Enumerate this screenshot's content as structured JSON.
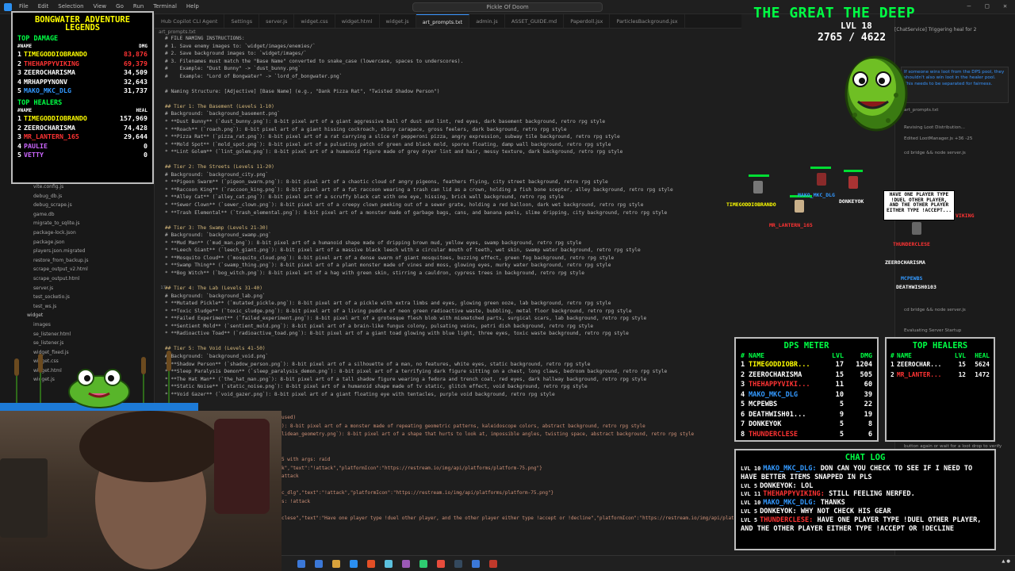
{
  "titlebar": {
    "menu": [
      "File",
      "Edit",
      "Selection",
      "View",
      "Go",
      "Run",
      "Terminal",
      "Help"
    ],
    "search": "Pickle Of Doom"
  },
  "tabs": [
    "Hub Copilot CLI Agent",
    "Settings",
    "server.js",
    "widget.css",
    "widget.html",
    "widget.js",
    "art_prompts.txt",
    "admin.js",
    "ASSET_GUIDE.md",
    "Paperdoll.jsx",
    "ParticlesBackground.jsx"
  ],
  "breadcrumb": "art_prompts.txt",
  "explorer": {
    "files": [
      {
        "name": "vite.config.js",
        "folder": false
      },
      {
        "name": "debug_db.js",
        "folder": false
      },
      {
        "name": "debug_scrape.js",
        "folder": false
      },
      {
        "name": "game.db",
        "folder": false
      },
      {
        "name": "migrate_to_sqlite.js",
        "folder": false
      },
      {
        "name": "package-lock.json",
        "folder": false
      },
      {
        "name": "package.json",
        "folder": false
      },
      {
        "name": "players.json.migrated",
        "folder": false
      },
      {
        "name": "restore_from_backup.js",
        "folder": false
      },
      {
        "name": "scrape_output_v2.html",
        "folder": false
      },
      {
        "name": "scrape_output.html",
        "folder": false
      },
      {
        "name": "server.js",
        "folder": false
      },
      {
        "name": "test_socketio.js",
        "folder": false
      },
      {
        "name": "test_ws.js",
        "folder": false
      },
      {
        "name": "widget",
        "folder": true
      },
      {
        "name": "images",
        "folder": false
      },
      {
        "name": "se_listener.html",
        "folder": false
      },
      {
        "name": "se_listener.js",
        "folder": false
      },
      {
        "name": "widget_fixed.js",
        "folder": false
      },
      {
        "name": "widget.css",
        "folder": false
      },
      {
        "name": "widget.html",
        "folder": false
      },
      {
        "name": "widget.js",
        "folder": false
      }
    ]
  },
  "editor": {
    "lines": [
      {
        "n": "",
        "text": "# FILE NAMING INSTRUCTIONS:",
        "h": false
      },
      {
        "n": "",
        "text": "# 1. Save enemy images to: `widget/images/enemies/`",
        "h": false
      },
      {
        "n": "",
        "text": "# 2. Save background images to: `widget/images/`",
        "h": false
      },
      {
        "n": "",
        "text": "# 3. Filenames must match the \"Base Name\" converted to snake_case (lowercase, spaces to underscores).",
        "h": false
      },
      {
        "n": "",
        "text": "#    Example: \"Dust Bunny\" -> `dust_bunny.png`",
        "h": false
      },
      {
        "n": "",
        "text": "#    Example: \"Lord of Bongwater\" -> `lord_of_bongwater.png`",
        "h": false
      },
      {
        "n": "",
        "text": "",
        "h": false
      },
      {
        "n": "",
        "text": "# Naming Structure: [Adjective] [Base Name] (e.g., \"Dank Pizza Rat\", \"Twisted Shadow Person\")",
        "h": false
      },
      {
        "n": "",
        "text": "",
        "h": false
      },
      {
        "n": "",
        "text": "## Tier 1: The Basement (Levels 1-10)",
        "h": true
      },
      {
        "n": "",
        "text": "# Background: `background_basement.png`",
        "h": false
      },
      {
        "n": "",
        "text": "* **Dust Bunny** (`dust_bunny.png`): 8-bit pixel art of a giant aggressive ball of dust and lint, red eyes, dark basement background, retro rpg style",
        "h": false
      },
      {
        "n": "",
        "text": "* **Roach** (`roach.png`): 8-bit pixel art of a giant hissing cockroach, shiny carapace, gross feelers, dark background, retro rpg style",
        "h": false
      },
      {
        "n": "",
        "text": "* **Pizza Rat** (`pizza_rat.png`): 8-bit pixel art of a rat carrying a slice of pepperoni pizza, angry expression, subway tile background, retro rpg style",
        "h": false
      },
      {
        "n": "",
        "text": "* **Mold Spot** (`mold_spot.png`): 8-bit pixel art of a pulsating patch of green and black mold, spores floating, damp wall background, retro rpg style",
        "h": false
      },
      {
        "n": "",
        "text": "* **Lint Golem** (`lint_golem.png`): 8-bit pixel art of a humanoid figure made of grey dryer lint and hair, messy texture, dark background, retro rpg style",
        "h": false
      },
      {
        "n": "",
        "text": "",
        "h": false
      },
      {
        "n": "",
        "text": "## Tier 2: The Streets (Levels 11-20)",
        "h": true
      },
      {
        "n": "",
        "text": "# Background: `background_city.png`",
        "h": false
      },
      {
        "n": "",
        "text": "* **Pigeon Swarm** (`pigeon_swarm.png`): 8-bit pixel art of a chaotic cloud of angry pigeons, feathers flying, city street background, retro rpg style",
        "h": false
      },
      {
        "n": "",
        "text": "* **Raccoon King** (`raccoon_king.png`): 8-bit pixel art of a fat raccoon wearing a trash can lid as a crown, holding a fish bone scepter, alley background, retro rpg style",
        "h": false
      },
      {
        "n": "",
        "text": "* **Alley Cat** (`alley_cat.png`): 8-bit pixel art of a scruffy black cat with one eye, hissing, brick wall background, retro rpg style",
        "h": false
      },
      {
        "n": "",
        "text": "* **Sewer Clown** (`sewer_clown.png`): 8-bit pixel art of a creepy clown peeking out of a sewer grate, holding a red balloon, dark wet background, retro rpg style",
        "h": false
      },
      {
        "n": "",
        "text": "* **Trash Elemental** (`trash_elemental.png`): 8-bit pixel art of a monster made of garbage bags, cans, and banana peels, slime dripping, city background, retro rpg style",
        "h": false
      },
      {
        "n": "",
        "text": "",
        "h": false
      },
      {
        "n": "",
        "text": "## Tier 3: The Swamp (Levels 21-30)",
        "h": true
      },
      {
        "n": "",
        "text": "# Background: `background_swamp.png`",
        "h": false
      },
      {
        "n": "",
        "text": "* **Mud Man** (`mud_man.png`): 8-bit pixel art of a humanoid shape made of dripping brown mud, yellow eyes, swamp background, retro rpg style",
        "h": false
      },
      {
        "n": "",
        "text": "* **Leech Giant** (`leech_giant.png`): 8-bit pixel art of a massive black leech with a circular mouth of teeth, wet skin, swamp water background, retro rpg style",
        "h": false
      },
      {
        "n": "",
        "text": "* **Mosquito Cloud** (`mosquito_cloud.png`): 8-bit pixel art of a dense swarm of giant mosquitoes, buzzing effect, green fog background, retro rpg style",
        "h": false
      },
      {
        "n": "",
        "text": "* **Swamp Thing** (`swamp_thing.png`): 8-bit pixel art of a plant monster made of vines and moss, glowing eyes, murky water background, retro rpg style",
        "h": false
      },
      {
        "n": "",
        "text": "* **Bog Witch** (`bog_witch.png`): 8-bit pixel art of a hag with green skin, stirring a cauldron, cypress trees in background, retro rpg style",
        "h": false
      },
      {
        "n": "",
        "text": "",
        "h": false
      },
      {
        "n": "17",
        "text": "## Tier 4: The Lab (Levels 31-40)",
        "h": true
      },
      {
        "n": "",
        "text": "# Background: `background_lab.png`",
        "h": false
      },
      {
        "n": "",
        "text": "* **Mutated Pickle** (`mutated_pickle.png`): 8-bit pixel art of a pickle with extra limbs and eyes, glowing green ooze, lab background, retro rpg style",
        "h": false
      },
      {
        "n": "",
        "text": "* **Toxic Sludge** (`toxic_sludge.png`): 8-bit pixel art of a living puddle of neon green radioactive waste, bubbling, metal floor background, retro rpg style",
        "h": false
      },
      {
        "n": "",
        "text": "* **Failed Experiment** (`failed_experiment.png`): 8-bit pixel art of a grotesque flesh blob with mismatched parts, surgical scars, lab background, retro rpg style",
        "h": false
      },
      {
        "n": "",
        "text": "* **Sentient Mold** (`sentient_mold.png`): 8-bit pixel art of a brain-like fungus colony, pulsating veins, petri dish background, retro rpg style",
        "h": false
      },
      {
        "n": "",
        "text": "* **Radioactive Toad** (`radioactive_toad.png`): 8-bit pixel art of a giant toad glowing with blue light, three eyes, toxic waste background, retro rpg style",
        "h": false
      },
      {
        "n": "",
        "text": "",
        "h": false
      },
      {
        "n": "",
        "text": "## Tier 5: The Void (Levels 41-50)",
        "h": true
      },
      {
        "n": "",
        "text": "# Background: `background_void.png`",
        "h": false
      },
      {
        "n": "",
        "text": "* **Shadow Person** (`shadow_person.png`): 8-bit pixel art of a silhouette of a man, no features, white eyes, static background, retro rpg style",
        "h": false
      },
      {
        "n": "",
        "text": "* **Sleep Paralysis Demon** (`sleep_paralysis_demon.png`): 8-bit pixel art of a terrifying dark figure sitting on a chest, long claws, bedroom background, retro rpg style",
        "h": false
      },
      {
        "n": "",
        "text": "* **The Hat Man** (`the_hat_man.png`): 8-bit pixel art of a tall shadow figure wearing a fedora and trench coat, red eyes, dark hallway background, retro rpg style",
        "h": false
      },
      {
        "n": "",
        "text": "* **Static Noise** (`static_noise.png`): 8-bit pixel art of a humanoid shape made of tv static, glitch effect, void background, retro rpg style",
        "h": false
      },
      {
        "n": "",
        "text": "* **Void Gazer** (`void_gazer.png`): 8-bit pixel art of a giant floating eye with tentacles, purple void background, retro rpg style",
        "h": false
      }
    ],
    "log": [
      "used)",
      "): 8-bit pixel art of a monster made of repeating geometric patterns, kaleidoscope colors, abstract background, retro rpg style",
      "lidean_geometry.png`): 8-bit pixel art of a shape that hurts to look at, impossible angles, twisting space, abstract background, retro rpg style",
      "",
      "",
      "5 with args: raid",
      "k\",\"text\":\"!attack\",\"platformIcon\":\"https://restream.io/img/api/platforms/platform-75.png\"}",
      "attack",
      "",
      "c_dlg\",\"text\":\"!attack\",\"platformIcon\":\"https://restream.io/img/api/platforms/platform-75.png\"}",
      "s: !attack",
      "",
      "clese\",\"text\":\"Have one player type !duel other player, and the other player either type !accept or !decline\",\"platformIcon\":\"https://restream.io/img/api/platforms/platform-75.png\"}"
    ]
  },
  "side_panel": {
    "service": "[ChatService] Triggering heal for 2",
    "copilot_note": "If someone wins loot from the DPS pool, they shouldn't also win loot in the healer pool. This needs to be separated for fairness.",
    "items": [
      "art_prompts.txt",
      "Revising Loot Distribution...",
      "Edited LootManager.js +36 -25",
      "cd bridge && node server.js",
      "cd bridge && node server.js",
      "Evaluating Server Startup",
      "button again or wait for a loot drop to verify"
    ]
  },
  "legends": {
    "title": "BONGWATER ADVENTURE LEGENDS",
    "damage_title": "TOP DAMAGE",
    "damage_cols": [
      "#NAME",
      "DMG"
    ],
    "damage": [
      {
        "rank": "1",
        "name": "TIMEGODDIOBRANDO",
        "value": "83,876",
        "color": "#ffff00",
        "vcolor": "#ff3333"
      },
      {
        "rank": "2",
        "name": "THEHAPPYVIKING",
        "value": "69,379",
        "color": "#ff3333",
        "vcolor": "#ff3333"
      },
      {
        "rank": "3",
        "name": "ZEEROCHARISMA",
        "value": "34,509",
        "color": "#ffffff",
        "vcolor": "#ffffff"
      },
      {
        "rank": "4",
        "name": "MRHAPPYNONV",
        "value": "32,643",
        "color": "#ffffff",
        "vcolor": "#ffffff"
      },
      {
        "rank": "5",
        "name": "MAKO_MKC_DLG",
        "value": "31,737",
        "color": "#3399ff",
        "vcolor": "#ffffff"
      }
    ],
    "healers_title": "TOP HEALERS",
    "healers_cols": [
      "#NAME",
      "HEAL"
    ],
    "healers": [
      {
        "rank": "1",
        "name": "TIMEGODDIOBRANDO",
        "value": "157,969",
        "color": "#ffff00",
        "vcolor": "#ffffff"
      },
      {
        "rank": "2",
        "name": "ZEEROCHARISMA",
        "value": "74,428",
        "color": "#ffffff",
        "vcolor": "#ffffff"
      },
      {
        "rank": "3",
        "name": "MR_LANTERN_165",
        "value": "29,644",
        "color": "#ff3333",
        "vcolor": "#ffffff"
      },
      {
        "rank": "4",
        "name": "PAULIE",
        "value": "0",
        "color": "#cc66ff",
        "vcolor": "#ffffff"
      },
      {
        "rank": "5",
        "name": "VETTY",
        "value": "0",
        "color": "#cc66ff",
        "vcolor": "#ffffff"
      }
    ]
  },
  "boss": {
    "title": "THE GREAT THE DEEP",
    "level": "LVL 18",
    "hp": "2765 / 4622"
  },
  "arena": {
    "players": [
      {
        "name": "TIMEGODDIOBRANDO",
        "color": "#ffff00"
      },
      {
        "name": "MAKO_MKC_DLG",
        "color": "#3399ff"
      },
      {
        "name": "DONKEYOK",
        "color": "#ffffff"
      },
      {
        "name": "MR_LANTERN_165",
        "color": "#ff3333"
      },
      {
        "name": "THUNDERCLESE",
        "color": "#ff3333"
      },
      {
        "name": "ZEEROCHARISMA",
        "color": "#ffffff"
      },
      {
        "name": "MCPEWBS",
        "color": "#3399ff"
      },
      {
        "name": "DEATHWISH0103",
        "color": "#ffffff"
      },
      {
        "name": "VIKING",
        "color": "#ff3333"
      }
    ],
    "speech": "HAVE ONE PLAYER TYPE !DUEL OTHER PLAYER, AND THE OTHER PLAYER EITHER TYPE !ACCEPT..."
  },
  "dps_meter": {
    "title": "DPS METER",
    "cols": [
      "#",
      "NAME",
      "LVL",
      "DMG"
    ],
    "rows": [
      {
        "rank": "1",
        "name": "TIMEGODDIOBR...",
        "lvl": "17",
        "val": "1204",
        "color": "#ffff00"
      },
      {
        "rank": "2",
        "name": "ZEEROCHARISMA",
        "lvl": "15",
        "val": "505",
        "color": "#ffffff"
      },
      {
        "rank": "3",
        "name": "THEHAPPYVIKI...",
        "lvl": "11",
        "val": "60",
        "color": "#ff3333"
      },
      {
        "rank": "4",
        "name": "MAKO_MKC_DLG",
        "lvl": "10",
        "val": "39",
        "color": "#3399ff"
      },
      {
        "rank": "5",
        "name": "MCPEWBS",
        "lvl": "5",
        "val": "22",
        "color": "#ffffff"
      },
      {
        "rank": "6",
        "name": "DEATHWISH01...",
        "lvl": "9",
        "val": "19",
        "color": "#ffffff"
      },
      {
        "rank": "7",
        "name": "DONKEYOK",
        "lvl": "5",
        "val": "8",
        "color": "#ffffff"
      },
      {
        "rank": "8",
        "name": "THUNDERCLESE",
        "lvl": "5",
        "val": "6",
        "color": "#ff3333"
      }
    ]
  },
  "healers_meter": {
    "title": "TOP HEALERS",
    "cols": [
      "#",
      "NAME",
      "LVL",
      "HEAL"
    ],
    "rows": [
      {
        "rank": "1",
        "name": "ZEEROCHAR...",
        "lvl": "15",
        "val": "5624",
        "color": "#ffffff"
      },
      {
        "rank": "2",
        "name": "MR_LANTER...",
        "lvl": "12",
        "val": "1472",
        "color": "#ff3333"
      }
    ]
  },
  "chat_log": {
    "title": "CHAT LOG",
    "messages": [
      {
        "lvl": "LVL 10",
        "name": "MAKO_MKC_DLG:",
        "color": "#3399ff",
        "text": "DON CAN YOU CHECK TO SEE IF I NEED TO HAVE BETTER ITEMS SNAPPED IN PLS"
      },
      {
        "lvl": "LVL 5",
        "name": "DONKEYOK:",
        "color": "#ffffff",
        "text": "LOL"
      },
      {
        "lvl": "LVL 11",
        "name": "THEHAPPYVIKING:",
        "color": "#ff3333",
        "text": "STILL FEELING NERFED."
      },
      {
        "lvl": "LVL 10",
        "name": "MAKO_MKC_DLG:",
        "color": "#3399ff",
        "text": "THANKS"
      },
      {
        "lvl": "LVL 5",
        "name": "DONKEYOK:",
        "color": "#ffffff",
        "text": "WHY NOT CHECK HIS GEAR"
      },
      {
        "lvl": "LVL 5",
        "name": "THUNDERCLESE:",
        "color": "#ff3333",
        "text": "HAVE ONE PLAYER TYPE !DUEL OTHER PLAYER, AND THE OTHER PLAYER EITHER TYPE !ACCEPT OR !DECLINE"
      }
    ]
  },
  "colors": {
    "accent_green": "#00ff44",
    "gold": "#ffff00",
    "vscode_bg": "#1e1e1e"
  }
}
